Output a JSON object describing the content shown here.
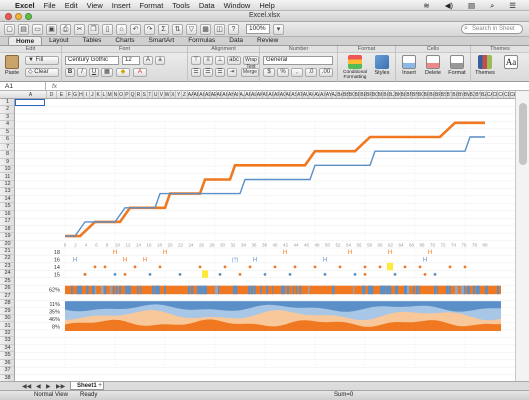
{
  "menubar": {
    "apple": "",
    "items": [
      "Excel",
      "File",
      "Edit",
      "View",
      "Insert",
      "Format",
      "Tools",
      "Data",
      "Window",
      "Help"
    ],
    "right": [
      "≋",
      "◀)",
      "▤",
      "⌕",
      "☰"
    ]
  },
  "window": {
    "title": "Excel.xlsx"
  },
  "toolbar": {
    "zoom": "100%",
    "search_placeholder": "Search in Sheet"
  },
  "ribbon_tabs": [
    "Home",
    "Layout",
    "Tables",
    "Charts",
    "SmartArt",
    "Formulas",
    "Data",
    "Review"
  ],
  "ribbon": {
    "groups": [
      "Edit",
      "Font",
      "Alignment",
      "Number",
      "Format",
      "Cells",
      "Themes"
    ],
    "paste": "Paste",
    "fill": "Fill",
    "clear": "Clear",
    "font_name": "Century Gothic",
    "font_size": "12",
    "wrap_text": "Wrap Text",
    "merge": "Merge",
    "number_format": "General",
    "conditional_formatting": "Conditional Formatting",
    "styles": "Styles",
    "insert": "Insert",
    "delete": "Delete",
    "format": "Format",
    "themes": "Themes",
    "abc": "abc"
  },
  "formula_bar": {
    "cell": "A1",
    "fx": "fx"
  },
  "columns": [
    "A",
    "D",
    "E",
    "F",
    "G",
    "H",
    "I",
    "J",
    "K",
    "L",
    "M",
    "N",
    "O",
    "P",
    "Q",
    "R",
    "S",
    "T",
    "U",
    "V",
    "W",
    "X",
    "Y",
    "Z",
    "AA",
    "AB",
    "AC",
    "AD",
    "AE",
    "AF",
    "AG",
    "AH",
    "AI",
    "AJ",
    "AK",
    "AL",
    "AM",
    "AN",
    "AO",
    "AP",
    "AQ",
    "AR",
    "AS",
    "AT",
    "AU",
    "AV",
    "AW",
    "AX",
    "AY",
    "AZ",
    "BA",
    "BB",
    "BC",
    "BD",
    "BE",
    "BF",
    "BG",
    "BH",
    "BI",
    "BJ",
    "BK",
    "BL",
    "BM",
    "BN",
    "BO",
    "BP",
    "BQ",
    "BR",
    "BS",
    "BT",
    "BU",
    "BV",
    "BW",
    "BX",
    "BY",
    "BZ",
    "CA",
    "CB",
    "CC",
    "CD",
    "CE",
    "CF",
    "CG",
    "FX"
  ],
  "rows": [
    "1",
    "2",
    "3",
    "4",
    "5",
    "6",
    "7",
    "8",
    "9",
    "10",
    "11",
    "12",
    "13",
    "14",
    "15",
    "16",
    "17",
    "18",
    "19",
    "20",
    "21",
    "22",
    "23",
    "24",
    "25",
    "26",
    "27",
    "28",
    "29",
    "30",
    "31",
    "32",
    "33",
    "34",
    "35",
    "36",
    "37",
    "38"
  ],
  "chart": {
    "x_ticks": [
      "0",
      "2",
      "4",
      "6",
      "8",
      "10",
      "12",
      "14",
      "16",
      "18",
      "20",
      "22",
      "24",
      "26",
      "28",
      "30",
      "32",
      "34",
      "36",
      "38",
      "40",
      "42",
      "44",
      "46",
      "48",
      "50",
      "52",
      "54",
      "56",
      "58",
      "60",
      "62",
      "64",
      "66",
      "68",
      "70",
      "72",
      "74",
      "76",
      "78",
      "80"
    ],
    "row_labels": [
      "18",
      "16",
      "14",
      "15"
    ],
    "band_label": "62%",
    "area_labels": [
      "11%",
      "35%",
      "46%",
      "8%"
    ],
    "h_marker": "H",
    "circle_marker": "(?)",
    "colors": {
      "orange": "#f07820",
      "blue": "#5b8fc7",
      "light_orange": "#f9c89a",
      "light_blue": "#a8c6e6",
      "highlight": "#ffea3a"
    }
  },
  "chart_data": [
    {
      "type": "line",
      "series": [
        {
          "color": "#f07820",
          "x": [
            0,
            3,
            6,
            11,
            13,
            20,
            21,
            27,
            28,
            33,
            34,
            48,
            50,
            58,
            61,
            75,
            78,
            84
          ],
          "y": [
            1,
            1,
            2,
            2,
            3,
            3,
            4,
            4,
            5,
            5,
            6,
            6,
            7,
            7,
            8,
            8,
            9,
            9
          ]
        },
        {
          "color": "#5b8fc7",
          "x": [
            0,
            2,
            4,
            10,
            12,
            18,
            19,
            35,
            36,
            49,
            50,
            61,
            62,
            80,
            81,
            84
          ],
          "y": [
            1,
            1,
            2,
            2,
            3,
            3,
            4,
            4,
            5,
            5,
            6,
            6,
            7,
            7,
            8,
            8
          ]
        }
      ],
      "xlim": [
        0,
        84
      ]
    }
  ],
  "sheet_tab": "Sheet1",
  "statusbar": {
    "view": "Normal View",
    "ready": "Ready",
    "sum": "Sum=0"
  }
}
